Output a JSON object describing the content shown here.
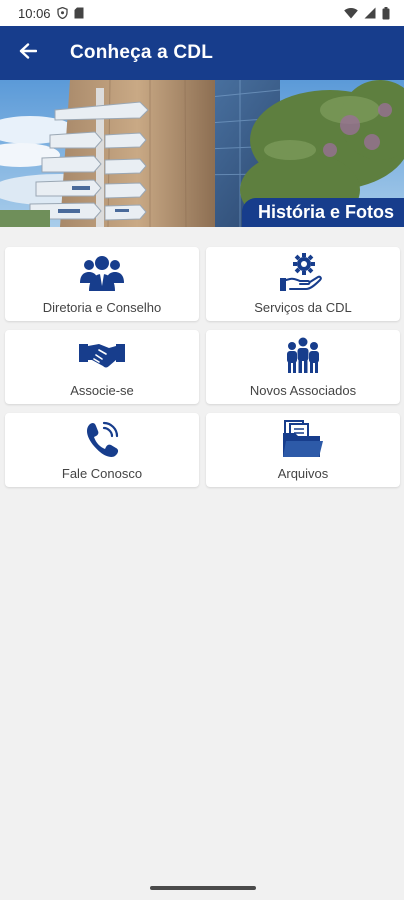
{
  "status_bar": {
    "time": "10:06"
  },
  "app_bar": {
    "title": "Conheça a CDL"
  },
  "banner": {
    "label": "História e Fotos"
  },
  "menu": {
    "items": [
      {
        "label": "Diretoria e Conselho",
        "icon": "board-people-icon"
      },
      {
        "label": "Serviços da CDL",
        "icon": "services-gear-hand-icon"
      },
      {
        "label": "Associe-se",
        "icon": "handshake-icon"
      },
      {
        "label": "Novos Associados",
        "icon": "new-members-icon"
      },
      {
        "label": "Fale Conosco",
        "icon": "phone-icon"
      },
      {
        "label": "Arquivos",
        "icon": "folder-files-icon"
      }
    ]
  },
  "colors": {
    "primary": "#173d8c",
    "background": "#f1f1f1",
    "card": "#ffffff"
  }
}
